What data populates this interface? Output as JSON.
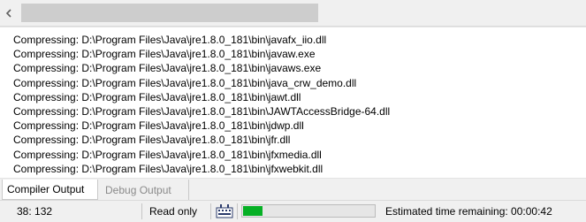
{
  "scrollbar": {
    "left_arrow_icon": "chevron-left-icon"
  },
  "output": {
    "lines": [
      "Compressing: D:\\Program Files\\Java\\jre1.8.0_181\\bin\\javafx_iio.dll",
      "Compressing: D:\\Program Files\\Java\\jre1.8.0_181\\bin\\javaw.exe",
      "Compressing: D:\\Program Files\\Java\\jre1.8.0_181\\bin\\javaws.exe",
      "Compressing: D:\\Program Files\\Java\\jre1.8.0_181\\bin\\java_crw_demo.dll",
      "Compressing: D:\\Program Files\\Java\\jre1.8.0_181\\bin\\jawt.dll",
      "Compressing: D:\\Program Files\\Java\\jre1.8.0_181\\bin\\JAWTAccessBridge-64.dll",
      "Compressing: D:\\Program Files\\Java\\jre1.8.0_181\\bin\\jdwp.dll",
      "Compressing: D:\\Program Files\\Java\\jre1.8.0_181\\bin\\jfr.dll",
      "Compressing: D:\\Program Files\\Java\\jre1.8.0_181\\bin\\jfxmedia.dll",
      "Compressing: D:\\Program Files\\Java\\jre1.8.0_181\\bin\\jfxwebkit.dll"
    ]
  },
  "tabs": [
    {
      "label": "Compiler Output",
      "active": true
    },
    {
      "label": "Debug Output",
      "active": false
    }
  ],
  "status": {
    "position": "38: 132",
    "mode": "Read only",
    "macro_icon": "macro-recorder-icon",
    "progress": 0.15,
    "progress_color": "#06b025",
    "eta_label": "Estimated time remaining: 00:00:42"
  }
}
